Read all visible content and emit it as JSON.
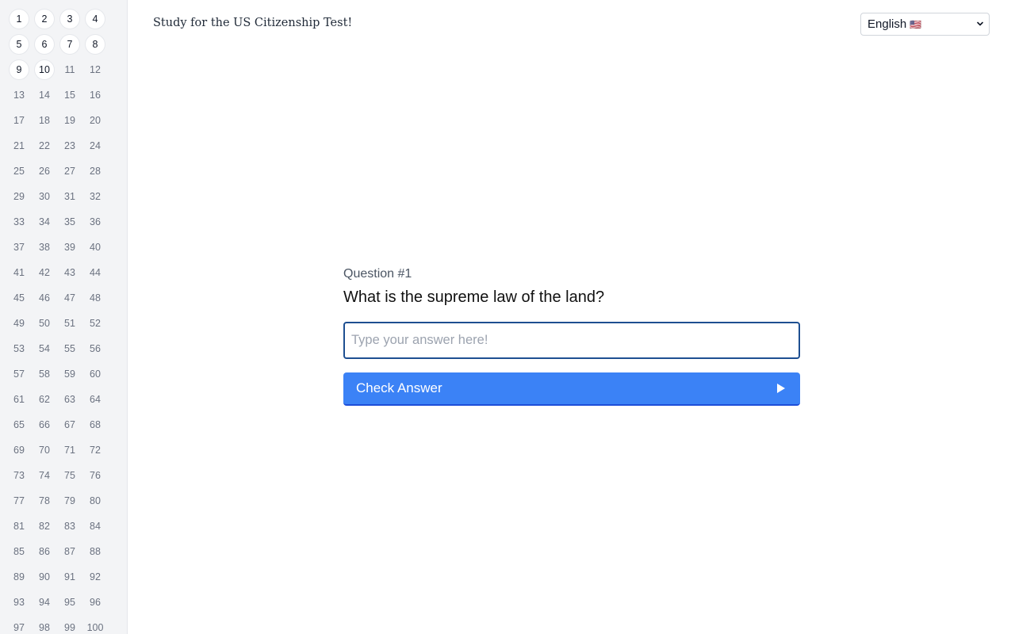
{
  "header": {
    "title": "Study for the US Citizenship Test!"
  },
  "language_select": {
    "value": "English",
    "flag": "🇺🇸"
  },
  "sidebar": {
    "question_numbers": [
      "1",
      "2",
      "3",
      "4",
      "5",
      "6",
      "7",
      "8",
      "9",
      "10",
      "11",
      "12",
      "13",
      "14",
      "15",
      "16",
      "17",
      "18",
      "19",
      "20",
      "21",
      "22",
      "23",
      "24",
      "25",
      "26",
      "27",
      "28",
      "29",
      "30",
      "31",
      "32",
      "33",
      "34",
      "35",
      "36",
      "37",
      "38",
      "39",
      "40",
      "41",
      "42",
      "43",
      "44",
      "45",
      "46",
      "47",
      "48",
      "49",
      "50",
      "51",
      "52",
      "53",
      "54",
      "55",
      "56",
      "57",
      "58",
      "59",
      "60",
      "61",
      "62",
      "63",
      "64",
      "65",
      "66",
      "67",
      "68",
      "69",
      "70",
      "71",
      "72",
      "73",
      "74",
      "75",
      "76",
      "77",
      "78",
      "79",
      "80",
      "81",
      "82",
      "83",
      "84",
      "85",
      "86",
      "87",
      "88",
      "89",
      "90",
      "91",
      "92",
      "93",
      "94",
      "95",
      "96",
      "97",
      "98",
      "99",
      "100"
    ],
    "unlocked_count": 10
  },
  "quiz": {
    "label": "Question #1",
    "question": "What is the supreme law of the land?",
    "answer_value": "",
    "answer_placeholder": "Type your answer here!",
    "check_label": "Check Answer"
  },
  "colors": {
    "accent": "#3b82f6",
    "input_border": "#1e4f91",
    "sidebar_bg": "#f3f4f6"
  },
  "icons": {
    "check_button": "play-icon",
    "select": "chevron-down-icon"
  }
}
